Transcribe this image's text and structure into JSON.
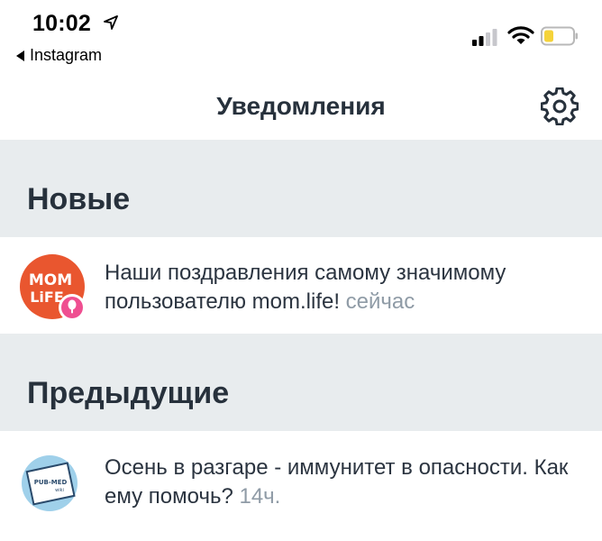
{
  "status_bar": {
    "time": "10:02",
    "back_app": "Instagram"
  },
  "header": {
    "title": "Уведомления"
  },
  "sections": {
    "new": {
      "title": "Новые",
      "items": [
        {
          "text": "Наши поздравления самому значимому пользователю mom.life!",
          "time": "сейчас",
          "avatar_text": [
            "MOM",
            "LiFE"
          ]
        }
      ]
    },
    "previous": {
      "title": "Предыдущие",
      "items": [
        {
          "text": "Осень в разгаре - иммунитет в опасности. Как ему помочь?",
          "time": "14ч.",
          "avatar_text": [
            "PUB-MED",
            "wiki"
          ]
        }
      ]
    }
  },
  "colors": {
    "section_bg": "#e8ecee",
    "title_text": "#27313c",
    "time_text": "#8f9ba6",
    "momlife_orange": "#e9562f",
    "badge_pink": "#ef4f91",
    "battery_yellow": "#f5d33a"
  },
  "icons": [
    "location-arrow-icon",
    "back-triangle-icon",
    "signal-icon",
    "wifi-icon",
    "battery-icon",
    "gear-icon"
  ]
}
